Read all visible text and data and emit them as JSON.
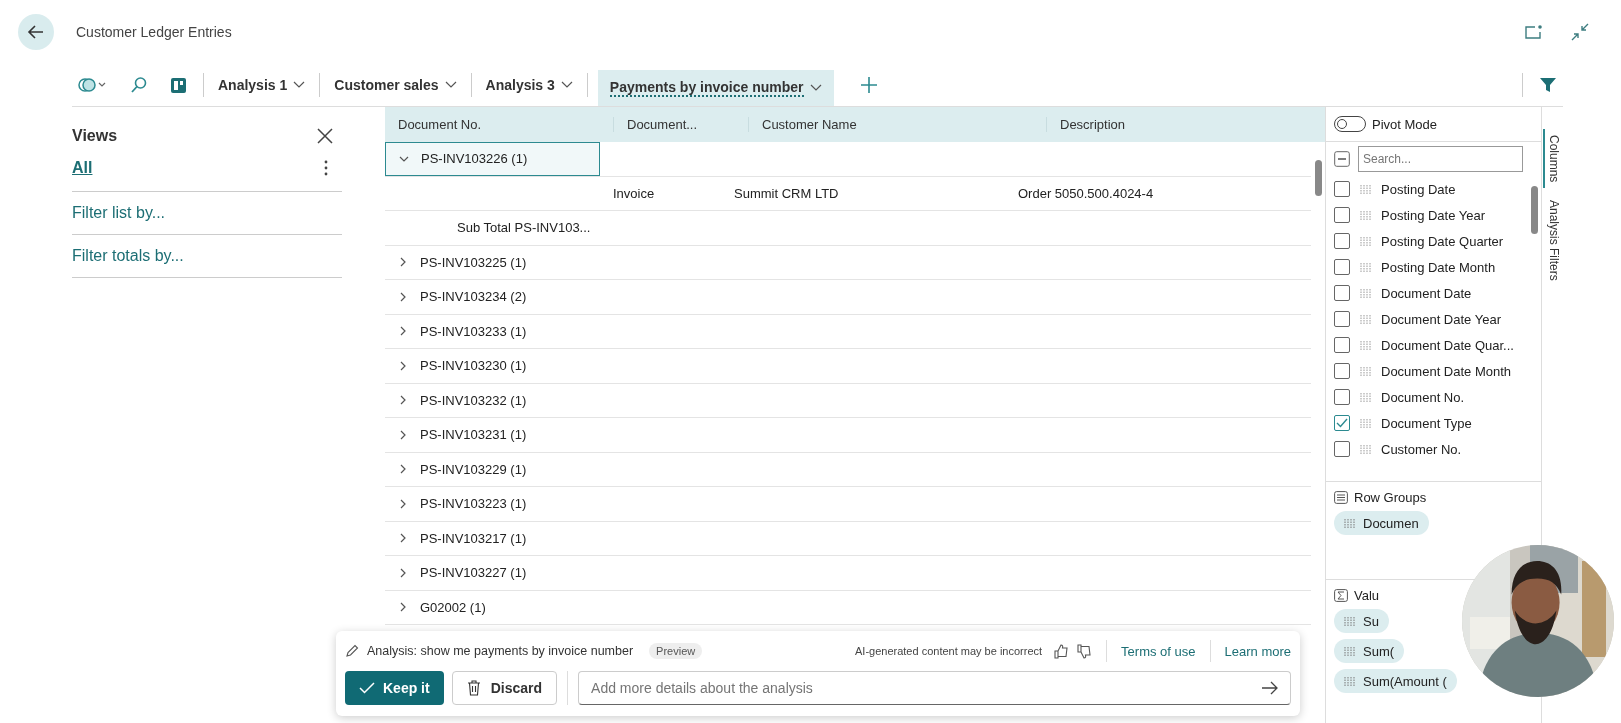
{
  "window": {
    "title": "Customer Ledger Entries"
  },
  "tabs": [
    {
      "label": "Analysis 1",
      "selected": false
    },
    {
      "label": "Customer sales",
      "selected": false
    },
    {
      "label": "Analysis 3",
      "selected": false
    },
    {
      "label": "Payments by invoice number",
      "selected": true
    }
  ],
  "views": {
    "title": "Views",
    "items": [
      {
        "label": "All",
        "selected": true
      }
    ],
    "links": [
      "Filter list by...",
      "Filter totals by..."
    ]
  },
  "table": {
    "columns": [
      "Document No.",
      "Document...",
      "Customer Name",
      "Description"
    ],
    "rows": [
      {
        "kind": "group",
        "label": "PS-INV103226 (1)",
        "expanded": true,
        "selected": true
      },
      {
        "kind": "detail",
        "cells": [
          "Invoice",
          "Summit CRM LTD",
          "Order 5050.500.4024-4"
        ]
      },
      {
        "kind": "subtotal",
        "label": "Sub Total PS-INV103..."
      },
      {
        "kind": "group",
        "label": "PS-INV103225 (1)",
        "expanded": false,
        "selected": false
      },
      {
        "kind": "group",
        "label": "PS-INV103234 (2)",
        "expanded": false,
        "selected": false
      },
      {
        "kind": "group",
        "label": "PS-INV103233 (1)",
        "expanded": false,
        "selected": false
      },
      {
        "kind": "group",
        "label": "PS-INV103230 (1)",
        "expanded": false,
        "selected": false
      },
      {
        "kind": "group",
        "label": "PS-INV103232 (1)",
        "expanded": false,
        "selected": false
      },
      {
        "kind": "group",
        "label": "PS-INV103231 (1)",
        "expanded": false,
        "selected": false
      },
      {
        "kind": "group",
        "label": "PS-INV103229 (1)",
        "expanded": false,
        "selected": false
      },
      {
        "kind": "group",
        "label": "PS-INV103223 (1)",
        "expanded": false,
        "selected": false
      },
      {
        "kind": "group",
        "label": "PS-INV103217 (1)",
        "expanded": false,
        "selected": false
      },
      {
        "kind": "group",
        "label": "PS-INV103227 (1)",
        "expanded": false,
        "selected": false
      },
      {
        "kind": "group",
        "label": "G02002 (1)",
        "expanded": false,
        "selected": false
      }
    ]
  },
  "column_panel": {
    "pivot_mode": {
      "label": "Pivot Mode",
      "on": false
    },
    "select_all_partial": true,
    "search": {
      "placeholder": "Search..."
    },
    "columns": [
      {
        "label": "Posting Date",
        "checked": false
      },
      {
        "label": "Posting Date Year",
        "checked": false
      },
      {
        "label": "Posting Date Quarter",
        "checked": false
      },
      {
        "label": "Posting Date Month",
        "checked": false
      },
      {
        "label": "Document Date",
        "checked": false
      },
      {
        "label": "Document Date Year",
        "checked": false
      },
      {
        "label": "Document Date Quar...",
        "checked": false
      },
      {
        "label": "Document Date Month",
        "checked": false
      },
      {
        "label": "Document No.",
        "checked": false
      },
      {
        "label": "Document Type",
        "checked": true
      },
      {
        "label": "Customer No.",
        "checked": false
      }
    ],
    "row_groups": {
      "title": "Row Groups",
      "chips": [
        "Documen"
      ]
    },
    "values": {
      "title": "Valu",
      "chips": [
        "Su",
        "Sum(",
        "Sum(Amount ("
      ]
    },
    "side_tabs": [
      {
        "label": "Columns",
        "selected": true
      },
      {
        "label": "Analysis Filters",
        "selected": false
      }
    ]
  },
  "ai_bar": {
    "prompt": "Analysis: show me payments by invoice number",
    "badge": "Preview",
    "disclaimer": "AI-generated content may be incorrect",
    "links": [
      "Terms of use",
      "Learn more"
    ],
    "keep": "Keep it",
    "discard": "Discard",
    "input": {
      "placeholder": "Add more details about the analysis"
    }
  }
}
